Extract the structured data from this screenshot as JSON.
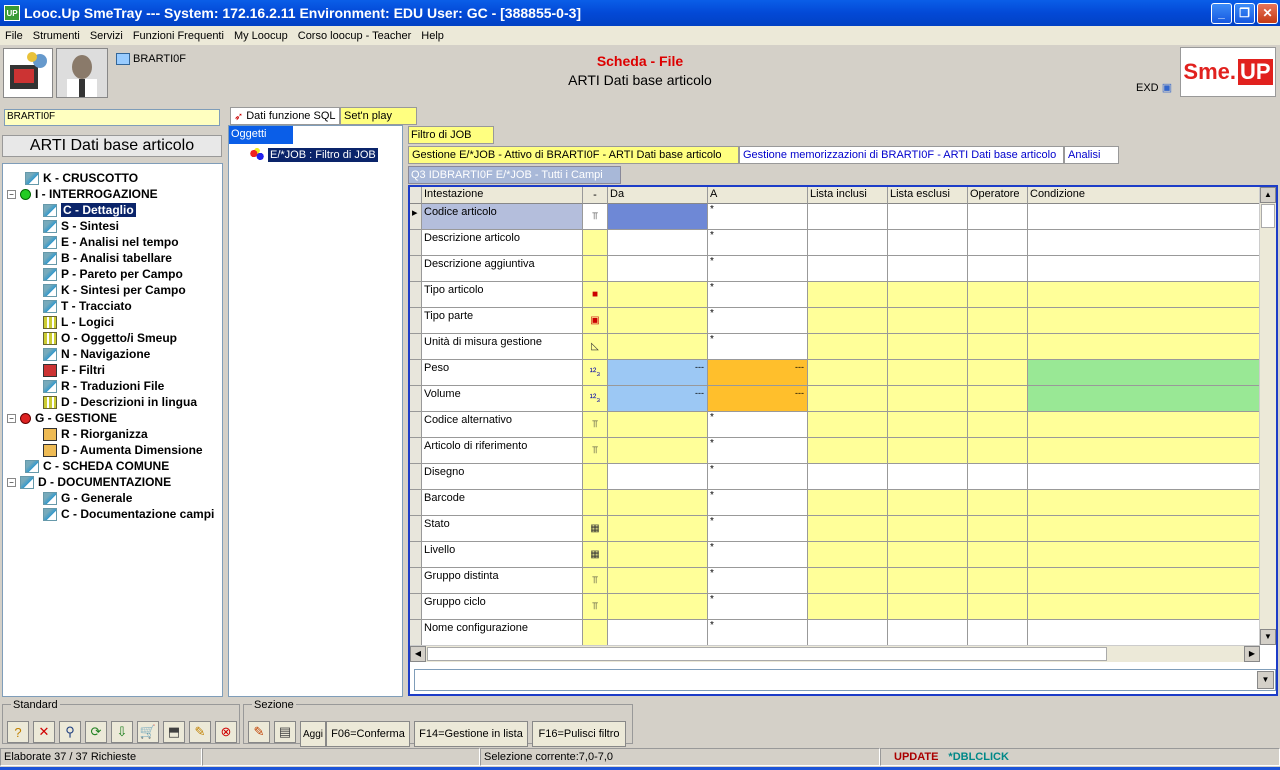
{
  "window": {
    "title": "Looc.Up SmeTray --- System: 172.16.2.11 Environment: EDU User: GC - [388855-0-3]",
    "app_icon": "UP"
  },
  "menu": [
    "File",
    "Strumenti",
    "Servizi",
    "Funzioni Frequenti",
    "My Loocup",
    "Corso loocup - Teacher",
    "Help"
  ],
  "header": {
    "object_label": "BRARTI0F",
    "scheda_title": "Scheda - File",
    "scheda_subtitle": "ARTI Dati base articolo",
    "exd": "EXD",
    "brand_left": "Sme.",
    "brand_right": "UP"
  },
  "left": {
    "input_value": "BRARTI0F",
    "title": "ARTI Dati base articolo",
    "tree": [
      {
        "label": "K - CRUSCOTTO",
        "level": 1,
        "icon": "page-icon"
      },
      {
        "label": "I - INTERROGAZIONE",
        "level": 0,
        "icon": "green-dot-icon",
        "expand": "−"
      },
      {
        "label": "C - Dettaglio",
        "level": 2,
        "icon": "page-icon",
        "selected": true
      },
      {
        "label": "S - Sintesi",
        "level": 2,
        "icon": "page-icon"
      },
      {
        "label": "E - Analisi nel tempo",
        "level": 2,
        "icon": "page-icon"
      },
      {
        "label": "B - Analisi tabellare",
        "level": 2,
        "icon": "page-icon"
      },
      {
        "label": "P - Pareto per Campo",
        "level": 2,
        "icon": "page-icon"
      },
      {
        "label": "K - Sintesi per Campo",
        "level": 2,
        "icon": "page-icon"
      },
      {
        "label": "T - Tracciato",
        "level": 2,
        "icon": "page-icon"
      },
      {
        "label": "L - Logici",
        "level": 2,
        "icon": "columns-icon"
      },
      {
        "label": "O - Oggetto/i Smeup",
        "level": 2,
        "icon": "columns-icon"
      },
      {
        "label": "N - Navigazione",
        "level": 2,
        "icon": "page-icon"
      },
      {
        "label": "F - Filtri",
        "level": 2,
        "icon": "filter-icon"
      },
      {
        "label": "R - Traduzioni File",
        "level": 2,
        "icon": "page-icon"
      },
      {
        "label": "D - Descrizioni in lingua",
        "level": 2,
        "icon": "columns-icon"
      },
      {
        "label": "G - GESTIONE",
        "level": 0,
        "icon": "red-dot-icon",
        "expand": "−"
      },
      {
        "label": "R - Riorganizza",
        "level": 2,
        "icon": "gear-icon"
      },
      {
        "label": "D - Aumenta Dimensione",
        "level": 2,
        "icon": "gear-icon"
      },
      {
        "label": "C - SCHEDA COMUNE",
        "level": 1,
        "icon": "page-icon"
      },
      {
        "label": "D - DOCUMENTAZIONE",
        "level": 0,
        "icon": "page-icon",
        "expand": "−"
      },
      {
        "label": "G - Generale",
        "level": 2,
        "icon": "page-icon"
      },
      {
        "label": "C - Documentazione campi",
        "level": 2,
        "icon": "page-icon"
      }
    ]
  },
  "middle": {
    "tab1": "Dati funzione SQL",
    "tab2": "Set'n play",
    "header": "Oggetti",
    "node": "E/*JOB : Filtro di JOB"
  },
  "right": {
    "tab_filtro": "Filtro di JOB",
    "tabs": [
      "Gestione E/*JOB - Attivo di BRARTI0F - ARTI Dati base articolo",
      "Gestione memorizzazioni di BRARTI0F - ARTI Dati base articolo",
      "Analisi"
    ],
    "subtab": "Q3 IDBRARTI0F E/*JOB - Tutti i Campi",
    "columns": [
      "Intestazione",
      "-",
      "Da",
      "A",
      "Lista inclusi",
      "Lista esclusi",
      "Operatore",
      "Condizione"
    ],
    "rows": [
      {
        "name": "Codice articolo",
        "icon": "key-icon",
        "glyph": "⫪",
        "da": "",
        "a": "*",
        "type": "selected"
      },
      {
        "name": "Descrizione articolo",
        "icon": "",
        "glyph": "",
        "da": "",
        "a": "*",
        "type": "white"
      },
      {
        "name": "Descrizione aggiuntiva",
        "icon": "",
        "glyph": "",
        "da": "",
        "a": "*",
        "type": "white"
      },
      {
        "name": "Tipo articolo",
        "icon": "cube-icon",
        "glyph": "■",
        "da": "",
        "a": "*",
        "type": "yellow"
      },
      {
        "name": "Tipo parte",
        "icon": "cube-parts-icon",
        "glyph": "▣",
        "da": "",
        "a": "*",
        "type": "yellow"
      },
      {
        "name": "Unità di misura gestione",
        "icon": "ruler-icon",
        "glyph": "◺",
        "da": "",
        "a": "*",
        "type": "yellow"
      },
      {
        "name": "Peso",
        "icon": "numbers-icon",
        "glyph": "¹²₃",
        "da": "---",
        "a": "---",
        "type": "range"
      },
      {
        "name": "Volume",
        "icon": "numbers-icon",
        "glyph": "¹²₃",
        "da": "---",
        "a": "---",
        "type": "range"
      },
      {
        "name": "Codice alternativo",
        "icon": "key-icon",
        "glyph": "⫪",
        "da": "",
        "a": "*",
        "type": "yellow"
      },
      {
        "name": "Articolo di riferimento",
        "icon": "key-icon",
        "glyph": "⫪",
        "da": "",
        "a": "*",
        "type": "yellow"
      },
      {
        "name": "Disegno",
        "icon": "",
        "glyph": "",
        "da": "",
        "a": "*",
        "type": "white"
      },
      {
        "name": "Barcode",
        "icon": "",
        "glyph": "",
        "da": "",
        "a": "*",
        "type": "yellow"
      },
      {
        "name": "Stato",
        "icon": "table-icon",
        "glyph": "▦",
        "da": "",
        "a": "*",
        "type": "yellow"
      },
      {
        "name": "Livello",
        "icon": "table-icon",
        "glyph": "▦",
        "da": "",
        "a": "*",
        "type": "yellow"
      },
      {
        "name": "Gruppo distinta",
        "icon": "key-icon",
        "glyph": "⫪",
        "da": "",
        "a": "*",
        "type": "yellow"
      },
      {
        "name": "Gruppo ciclo",
        "icon": "key-icon",
        "glyph": "⫪",
        "da": "",
        "a": "*",
        "type": "yellow"
      },
      {
        "name": "Nome configurazione",
        "icon": "",
        "glyph": "",
        "da": "",
        "a": "*",
        "type": "white"
      }
    ]
  },
  "bottom": {
    "standard_label": "Standard",
    "sezione_label": "Sezione",
    "standard_icons": [
      {
        "name": "help-icon",
        "glyph": "?",
        "color": "#c08000"
      },
      {
        "name": "cancel-icon",
        "glyph": "✕",
        "color": "#d00000"
      },
      {
        "name": "search-icon",
        "glyph": "⚲",
        "color": "#204080"
      },
      {
        "name": "refresh-icon",
        "glyph": "⟳",
        "color": "#208020"
      },
      {
        "name": "back-icon",
        "glyph": "⇩",
        "color": "#208020"
      },
      {
        "name": "cart-icon",
        "glyph": "🛒",
        "color": "#404040"
      },
      {
        "name": "export-icon",
        "glyph": "⬒",
        "color": "#404040"
      },
      {
        "name": "zoom-icon",
        "glyph": "✎",
        "color": "#c08000"
      },
      {
        "name": "stop-icon",
        "glyph": "⊗",
        "color": "#d00000"
      }
    ],
    "sezione_icons": [
      {
        "name": "edit-icon",
        "glyph": "✎",
        "color": "#c04000"
      },
      {
        "name": "list-icon",
        "glyph": "▤",
        "color": "#404040"
      }
    ],
    "aggi": "Aggi",
    "buttons": [
      "F06=Conferma",
      "F14=Gestione in lista",
      "F16=Pulisci filtro"
    ]
  },
  "status": {
    "elaborate": "Elaborate 37 / 37 Richieste",
    "selezione": "Selezione corrente:7,0-7,0",
    "update": "UPDATE",
    "dblclick": "*DBLCLICK"
  }
}
